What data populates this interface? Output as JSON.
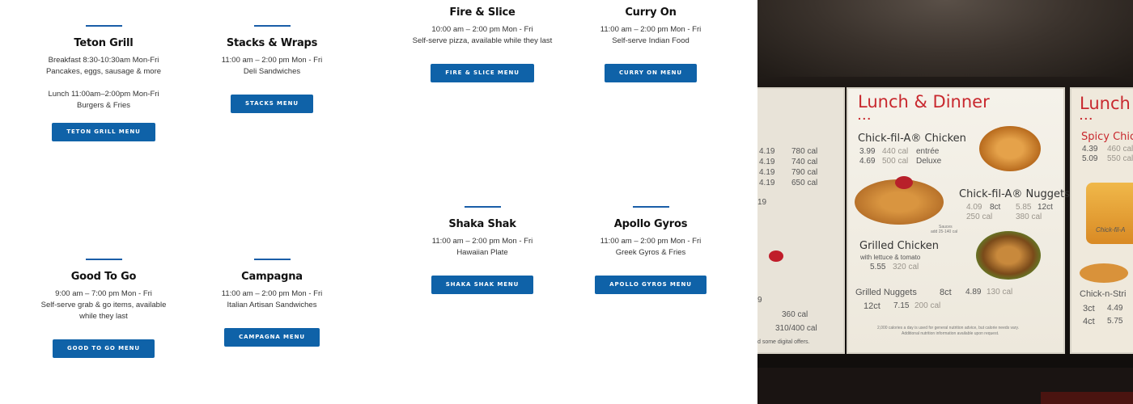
{
  "restaurants": [
    {
      "name": "Teton Grill",
      "lines": [
        "Breakfast 8:30-10:30am Mon-Fri",
        "Pancakes, eggs, sausage & more",
        "",
        "Lunch 11:00am–2:00pm Mon-Fri",
        "Burgers & Fries"
      ],
      "button": "TETON GRILL MENU"
    },
    {
      "name": "Stacks & Wraps",
      "lines": [
        "11:00 am – 2:00 pm Mon - Fri",
        "Deli Sandwiches"
      ],
      "button": "STACKS MENU"
    },
    {
      "name": "Fire & Slice",
      "lines": [
        "10:00 am – 2:00 pm Mon - Fri",
        "Self-serve pizza, available while they last"
      ],
      "button": "FIRE & SLICE MENU"
    },
    {
      "name": "Curry On",
      "lines": [
        "11:00 am – 2:00 pm Mon - Fri",
        "Self-serve Indian Food"
      ],
      "button": "CURRY ON MENU"
    },
    {
      "name": "Shaka Shak",
      "lines": [
        "11:00 am – 2:00 pm Mon - Fri",
        "Hawaiian Plate"
      ],
      "button": "SHAKA SHAK MENU"
    },
    {
      "name": "Apollo Gyros",
      "lines": [
        "11:00 am – 2:00 pm Mon - Fri",
        "Greek Gyros & Fries"
      ],
      "button": "APOLLO GYROS MENU"
    },
    {
      "name": "Good To Go",
      "lines": [
        "9:00 am – 7:00 pm Mon - Fri",
        "Self-serve grab & go items, available",
        "while they last"
      ],
      "button": "GOOD TO GO MENU"
    },
    {
      "name": "Campagna",
      "lines": [
        "11:00 am – 2:00 pm Mon - Fri",
        "Italian Artisan Sandwiches"
      ],
      "button": "CAMPAGNA MENU"
    }
  ],
  "photo": {
    "left_panel": {
      "values": [
        "4.19",
        "780 cal",
        "4.19",
        "740 cal",
        "4.19",
        "790 cal",
        "4.19",
        "650 cal",
        "360 cal",
        "310/400 cal",
        "9",
        "19"
      ],
      "footer": "d some digital offers."
    },
    "center_panel": {
      "title": "Lunch & Dinner",
      "dots": "...",
      "chicken": {
        "name": "Chick-fil-A® Chicken",
        "price1": "3.99",
        "cal1": "440 cal",
        "label1": "entrée",
        "price2": "4.69",
        "cal2": "500 cal",
        "label2": "Deluxe"
      },
      "nuggets": {
        "name": "Chick-fil-A® Nuggets",
        "count1": "8ct",
        "price1": "4.09",
        "cal1": "250 cal",
        "count2": "12ct",
        "price2": "5.85",
        "cal2": "380 cal",
        "sauce": "Sauces",
        "sauce_cal": "add 25-140 cal"
      },
      "grilled": {
        "name": "Grilled Chicken",
        "sub": "with lettuce & tomato",
        "price": "5.55",
        "cal": "320 cal"
      },
      "grilled_nuggets": {
        "name": "Grilled Nuggets",
        "count1": "8ct",
        "price1": "4.89",
        "cal1": "130 cal",
        "count2": "12ct",
        "price2": "7.15",
        "cal2": "200 cal"
      },
      "disclaimer1": "2,000 calories a day is used for general nutrition advice, but calorie needs vary.",
      "disclaimer2": "Additional nutrition information available upon request."
    },
    "right_panel": {
      "title": "Lunch",
      "dots": "...",
      "spicy": "Spicy Chic",
      "spicy_p1": "4.39",
      "spicy_c1": "460 cal",
      "spicy_p2": "5.09",
      "spicy_c2": "550 cal",
      "strips": "Chick-n-Stri",
      "strips_c1": "3ct",
      "strips_p1": "4.49",
      "strips_c2": "4ct",
      "strips_p2": "5.75",
      "brand": "Chick-fil-A"
    }
  }
}
